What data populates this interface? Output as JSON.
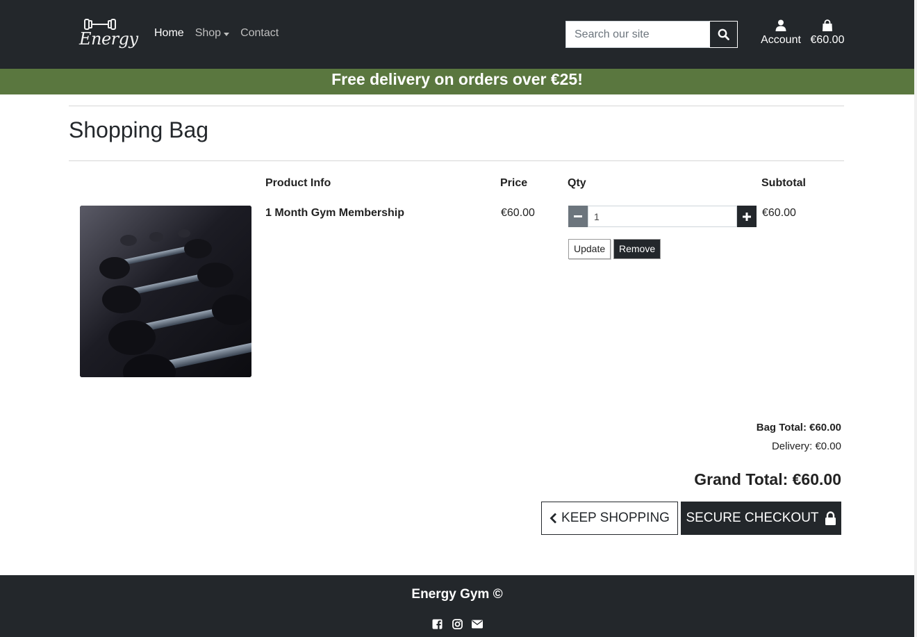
{
  "brand": {
    "logo_text": "Energy"
  },
  "nav": {
    "home": "Home",
    "shop": "Shop",
    "contact": "Contact"
  },
  "search": {
    "placeholder": "Search our site"
  },
  "account": {
    "label": "Account"
  },
  "bag": {
    "total": "€60.00"
  },
  "promo": {
    "text": "Free delivery on orders over €25!"
  },
  "page": {
    "title": "Shopping Bag"
  },
  "table": {
    "headers": {
      "product_info": "Product Info",
      "price": "Price",
      "qty": "Qty",
      "subtotal": "Subtotal"
    },
    "items": [
      {
        "name": "1 Month Gym Membership",
        "price": "€60.00",
        "qty": "1",
        "subtotal": "€60.00"
      }
    ]
  },
  "actions": {
    "update": "Update",
    "remove": "Remove"
  },
  "summary": {
    "bag_total": "Bag Total: €60.00",
    "delivery": "Delivery: €0.00",
    "grand_total": "Grand Total: €60.00"
  },
  "buttons": {
    "keep_shopping": "KEEP SHOPPING",
    "secure_checkout": "SECURE CHECKOUT"
  },
  "footer": {
    "title": "Energy Gym ©"
  },
  "colors": {
    "dark": "#23272b",
    "promo": "#5a773f",
    "qty_minus": "#6c757d"
  }
}
